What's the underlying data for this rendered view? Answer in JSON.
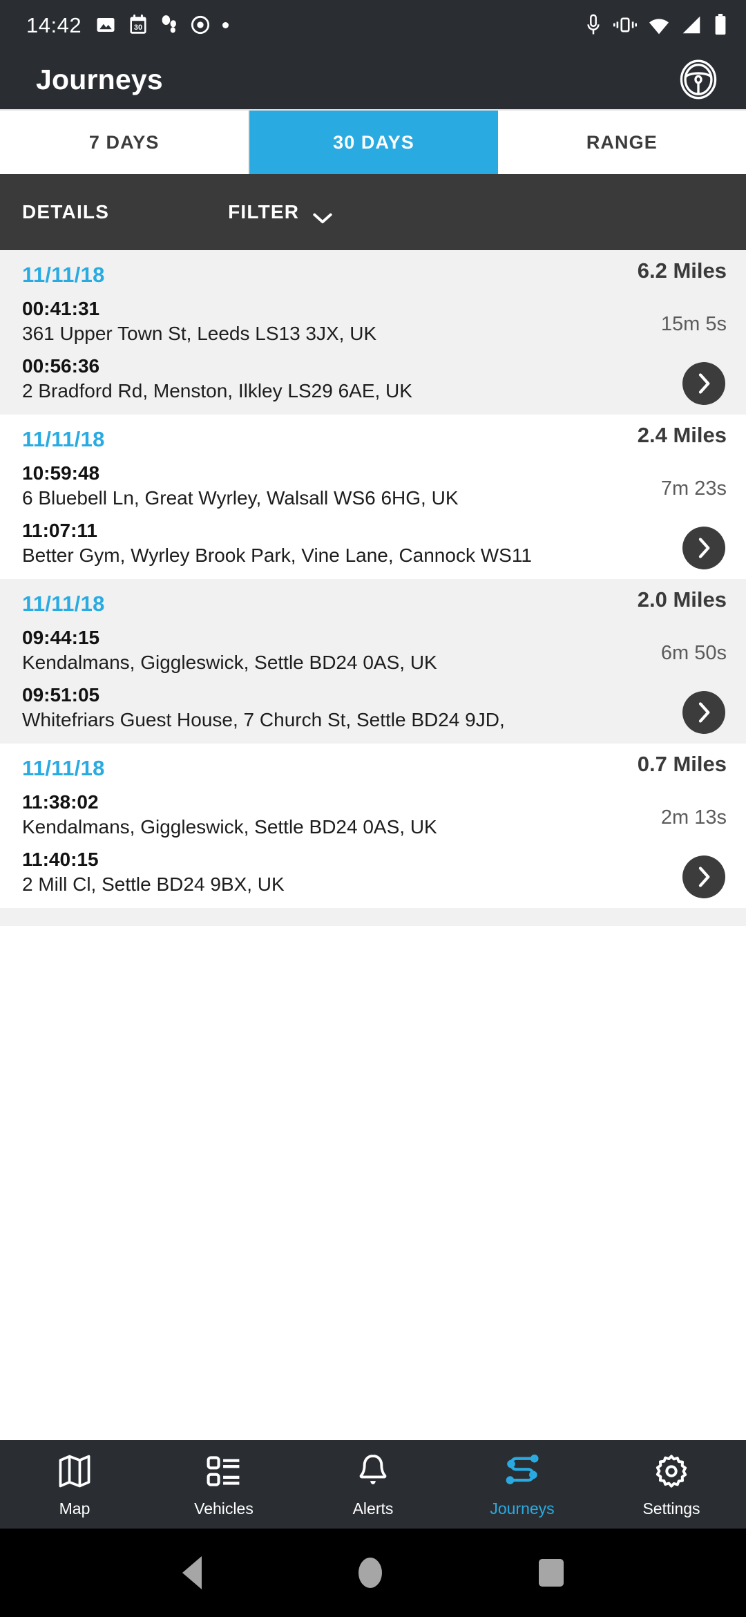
{
  "status_bar": {
    "time": "14:42",
    "left_icons": [
      "image-icon",
      "calendar-30-icon",
      "footprints-icon",
      "record-circle-icon",
      "small-dot-icon"
    ],
    "right_icons": [
      "microphone-icon",
      "vibrate-icon",
      "wifi-icon",
      "signal-icon",
      "battery-icon"
    ]
  },
  "app_bar": {
    "title": "Journeys",
    "action_icon": "steering-wheel-icon"
  },
  "tabs": [
    {
      "label": "7 DAYS",
      "active": false
    },
    {
      "label": "30 DAYS",
      "active": true
    },
    {
      "label": "RANGE",
      "active": false
    }
  ],
  "filter_bar": {
    "details_label": "DETAILS",
    "filter_label": "FILTER",
    "chevron_icon": "chevron-down-icon"
  },
  "journeys": [
    {
      "date": "11/11/18",
      "miles": "6.2 Miles",
      "duration": "15m 5s",
      "start_time": "00:41:31",
      "start_address": "361 Upper Town St, Leeds LS13 3JX, UK",
      "end_time": "00:56:36",
      "end_address": "2 Bradford Rd, Menston, Ilkley LS29 6AE, UK",
      "arrow_icon": "chevron-right-icon"
    },
    {
      "date": "11/11/18",
      "miles": "2.4 Miles",
      "duration": "7m 23s",
      "start_time": "10:59:48",
      "start_address": "6 Bluebell Ln, Great Wyrley, Walsall WS6 6HG, UK",
      "end_time": "11:07:11",
      "end_address": "Better Gym, Wyrley Brook Park, Vine Lane, Cannock WS11",
      "arrow_icon": "chevron-right-icon"
    },
    {
      "date": "11/11/18",
      "miles": "2.0 Miles",
      "duration": "6m 50s",
      "start_time": "09:44:15",
      "start_address": "Kendalmans, Giggleswick, Settle BD24 0AS, UK",
      "end_time": "09:51:05",
      "end_address": "Whitefriars Guest House, 7 Church St, Settle BD24 9JD,",
      "arrow_icon": "chevron-right-icon"
    },
    {
      "date": "11/11/18",
      "miles": "0.7 Miles",
      "duration": "2m 13s",
      "start_time": "11:38:02",
      "start_address": "Kendalmans, Giggleswick, Settle BD24 0AS, UK",
      "end_time": "11:40:15",
      "end_address": "2 Mill Cl, Settle BD24 9BX, UK",
      "arrow_icon": "chevron-right-icon"
    }
  ],
  "bottom_nav": [
    {
      "label": "Map",
      "icon": "map-icon",
      "active": false
    },
    {
      "label": "Vehicles",
      "icon": "vehicles-list-icon",
      "active": false
    },
    {
      "label": "Alerts",
      "icon": "bell-icon",
      "active": false
    },
    {
      "label": "Journeys",
      "icon": "route-icon",
      "active": true
    },
    {
      "label": "Settings",
      "icon": "gear-icon",
      "active": false
    }
  ],
  "system_nav": {
    "back": "back-triangle-icon",
    "home": "home-circle-icon",
    "recents": "recents-square-icon"
  },
  "colors": {
    "accent": "#29abe2",
    "header_bg": "#2a2e33",
    "filter_bg": "#3a3a3a",
    "row_alt_bg": "#f1f1f1"
  }
}
